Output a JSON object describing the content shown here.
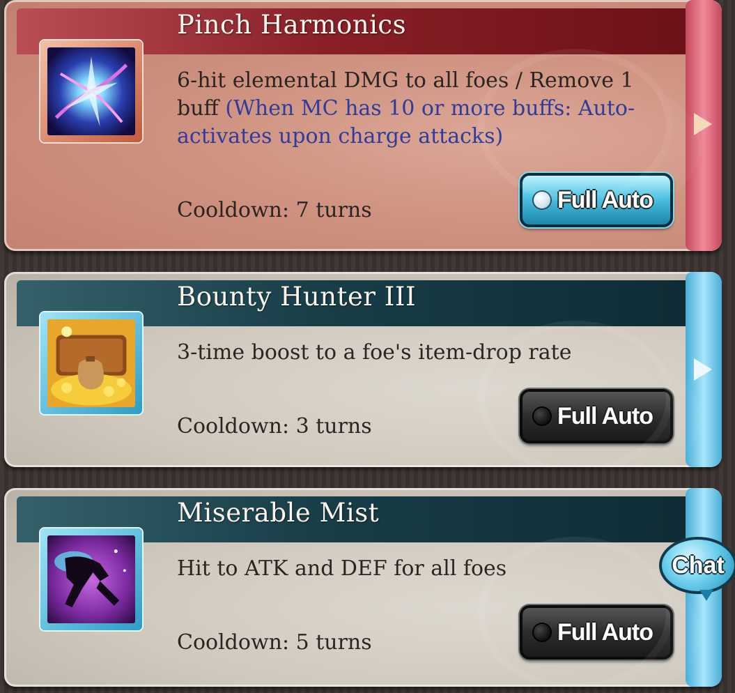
{
  "skills": [
    {
      "name": "Pinch Harmonics",
      "description": "6-hit elemental DMG to all foes / Remove 1 buff",
      "condition": "(When MC has 10 or more buffs: Auto-activates upon charge attacks)",
      "cooldown": "Cooldown: 7 turns",
      "full_auto_label": "Full Auto",
      "full_auto_enabled": true,
      "theme": "red"
    },
    {
      "name": "Bounty Hunter III",
      "description": "3-time boost to a foe's item-drop rate",
      "cooldown": "Cooldown: 3 turns",
      "full_auto_label": "Full Auto",
      "full_auto_enabled": false,
      "theme": "teal"
    },
    {
      "name": "Miserable Mist",
      "description": "Hit to ATK and DEF for all foes",
      "cooldown": "Cooldown: 5 turns",
      "full_auto_label": "Full Auto",
      "full_auto_enabled": false,
      "theme": "teal"
    }
  ],
  "chat_button": {
    "label": "Chat"
  },
  "colors": {
    "red_header": "#8a2028",
    "teal_header": "#183e48",
    "condition_text": "#2f3c9a",
    "auto_on": "#4cc3e3",
    "auto_off": "#2d2d2d"
  }
}
